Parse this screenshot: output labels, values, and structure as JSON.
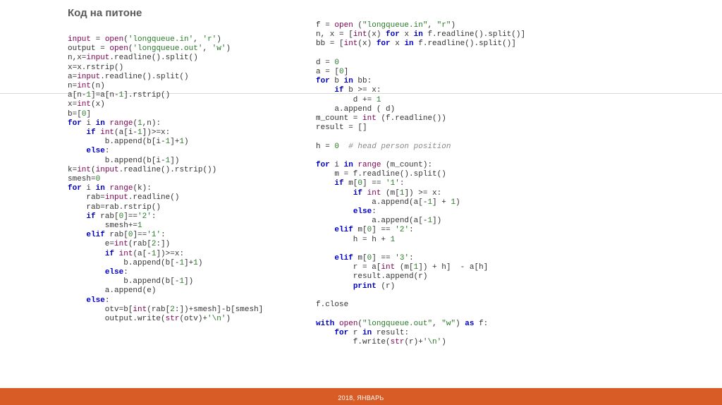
{
  "title": "Код на питоне",
  "footer": "2018, ЯНВАРЬ",
  "code": {
    "left": [
      {
        "t": "input",
        "c": "fn"
      },
      {
        "t": " = "
      },
      {
        "t": "open",
        "c": "fn"
      },
      {
        "t": "("
      },
      {
        "t": "'longqueue.in'",
        "c": "str"
      },
      {
        "t": ", "
      },
      {
        "t": "'r'",
        "c": "str"
      },
      {
        "t": ")"
      },
      {
        "br": 1
      },
      {
        "t": "output = "
      },
      {
        "t": "open",
        "c": "fn"
      },
      {
        "t": "("
      },
      {
        "t": "'longqueue.out'",
        "c": "str"
      },
      {
        "t": ", "
      },
      {
        "t": "'w'",
        "c": "str"
      },
      {
        "t": ")"
      },
      {
        "br": 1
      },
      {
        "t": "n,x="
      },
      {
        "t": "input",
        "c": "fn"
      },
      {
        "t": ".readline().split()"
      },
      {
        "br": 1
      },
      {
        "t": "x=x.rstrip()"
      },
      {
        "br": 1
      },
      {
        "t": "a="
      },
      {
        "t": "input",
        "c": "fn"
      },
      {
        "t": ".readline().split()"
      },
      {
        "br": 1
      },
      {
        "t": "n="
      },
      {
        "t": "int",
        "c": "fn"
      },
      {
        "t": "(n)"
      },
      {
        "br": 1
      },
      {
        "t": "a[n-"
      },
      {
        "t": "1",
        "c": "num"
      },
      {
        "t": "]=a[n-"
      },
      {
        "t": "1",
        "c": "num"
      },
      {
        "t": "].rstrip()"
      },
      {
        "br": 1
      },
      {
        "t": "x="
      },
      {
        "t": "int",
        "c": "fn"
      },
      {
        "t": "(x)"
      },
      {
        "br": 1
      },
      {
        "t": "b=["
      },
      {
        "t": "0",
        "c": "num"
      },
      {
        "t": "]"
      },
      {
        "br": 1
      },
      {
        "t": "for",
        "c": "kw"
      },
      {
        "t": " i "
      },
      {
        "t": "in",
        "c": "kw"
      },
      {
        "t": " "
      },
      {
        "t": "range",
        "c": "fn"
      },
      {
        "t": "("
      },
      {
        "t": "1",
        "c": "num"
      },
      {
        "t": ",n):"
      },
      {
        "br": 1
      },
      {
        "t": "    "
      },
      {
        "t": "if",
        "c": "kw"
      },
      {
        "t": " "
      },
      {
        "t": "int",
        "c": "fn"
      },
      {
        "t": "(a[i-"
      },
      {
        "t": "1",
        "c": "num"
      },
      {
        "t": "])>=x:"
      },
      {
        "br": 1
      },
      {
        "t": "        b.append(b[i-"
      },
      {
        "t": "1",
        "c": "num"
      },
      {
        "t": "]+"
      },
      {
        "t": "1",
        "c": "num"
      },
      {
        "t": ")"
      },
      {
        "br": 1
      },
      {
        "t": "    "
      },
      {
        "t": "else",
        "c": "kw"
      },
      {
        "t": ":"
      },
      {
        "br": 1
      },
      {
        "t": "        b.append(b[i-"
      },
      {
        "t": "1",
        "c": "num"
      },
      {
        "t": "])"
      },
      {
        "br": 1
      },
      {
        "t": "k="
      },
      {
        "t": "int",
        "c": "fn"
      },
      {
        "t": "("
      },
      {
        "t": "input",
        "c": "fn"
      },
      {
        "t": ".readline().rstrip())"
      },
      {
        "br": 1
      },
      {
        "t": "smesh="
      },
      {
        "t": "0",
        "c": "num"
      },
      {
        "br": 1
      },
      {
        "t": "for",
        "c": "kw"
      },
      {
        "t": " i "
      },
      {
        "t": "in",
        "c": "kw"
      },
      {
        "t": " "
      },
      {
        "t": "range",
        "c": "fn"
      },
      {
        "t": "(k):"
      },
      {
        "br": 1
      },
      {
        "t": "    rab="
      },
      {
        "t": "input",
        "c": "fn"
      },
      {
        "t": ".readline()"
      },
      {
        "br": 1
      },
      {
        "t": "    rab=rab.rstrip()"
      },
      {
        "br": 1
      },
      {
        "t": "    "
      },
      {
        "t": "if",
        "c": "kw"
      },
      {
        "t": " rab["
      },
      {
        "t": "0",
        "c": "num"
      },
      {
        "t": "]=="
      },
      {
        "t": "'2'",
        "c": "str"
      },
      {
        "t": ":"
      },
      {
        "br": 1
      },
      {
        "t": "        smesh+="
      },
      {
        "t": "1",
        "c": "num"
      },
      {
        "br": 1
      },
      {
        "t": "    "
      },
      {
        "t": "elif",
        "c": "kw"
      },
      {
        "t": " rab["
      },
      {
        "t": "0",
        "c": "num"
      },
      {
        "t": "]=="
      },
      {
        "t": "'1'",
        "c": "str"
      },
      {
        "t": ":"
      },
      {
        "br": 1
      },
      {
        "t": "        e="
      },
      {
        "t": "int",
        "c": "fn"
      },
      {
        "t": "(rab["
      },
      {
        "t": "2",
        "c": "num"
      },
      {
        "t": ":])"
      },
      {
        "br": 1
      },
      {
        "t": "        "
      },
      {
        "t": "if",
        "c": "kw"
      },
      {
        "t": " "
      },
      {
        "t": "int",
        "c": "fn"
      },
      {
        "t": "(a[-"
      },
      {
        "t": "1",
        "c": "num"
      },
      {
        "t": "])>=x:"
      },
      {
        "br": 1
      },
      {
        "t": "            b.append(b[-"
      },
      {
        "t": "1",
        "c": "num"
      },
      {
        "t": "]+"
      },
      {
        "t": "1",
        "c": "num"
      },
      {
        "t": ")"
      },
      {
        "br": 1
      },
      {
        "t": "        "
      },
      {
        "t": "else",
        "c": "kw"
      },
      {
        "t": ":"
      },
      {
        "br": 1
      },
      {
        "t": "            b.append(b[-"
      },
      {
        "t": "1",
        "c": "num"
      },
      {
        "t": "])"
      },
      {
        "br": 1
      },
      {
        "t": "        a.append(e)"
      },
      {
        "br": 1
      },
      {
        "t": "    "
      },
      {
        "t": "else",
        "c": "kw"
      },
      {
        "t": ":"
      },
      {
        "br": 1
      },
      {
        "t": "        otv=b["
      },
      {
        "t": "int",
        "c": "fn"
      },
      {
        "t": "(rab["
      },
      {
        "t": "2",
        "c": "num"
      },
      {
        "t": ":])+smesh]-b[smesh]"
      },
      {
        "br": 1
      },
      {
        "t": "        output.write("
      },
      {
        "t": "str",
        "c": "fn"
      },
      {
        "t": "(otv)+"
      },
      {
        "t": "'\\n'",
        "c": "str"
      },
      {
        "t": ")"
      }
    ],
    "right": [
      {
        "t": "f = "
      },
      {
        "t": "open",
        "c": "fn"
      },
      {
        "t": " ("
      },
      {
        "t": "\"longqueue.in\"",
        "c": "str"
      },
      {
        "t": ", "
      },
      {
        "t": "\"r\"",
        "c": "str"
      },
      {
        "t": ")"
      },
      {
        "br": 1
      },
      {
        "t": "n, x = ["
      },
      {
        "t": "int",
        "c": "fn"
      },
      {
        "t": "(x) "
      },
      {
        "t": "for",
        "c": "kw"
      },
      {
        "t": " x "
      },
      {
        "t": "in",
        "c": "kw"
      },
      {
        "t": " f.readline().split()]"
      },
      {
        "br": 1
      },
      {
        "t": "bb = ["
      },
      {
        "t": "int",
        "c": "fn"
      },
      {
        "t": "(x) "
      },
      {
        "t": "for",
        "c": "kw"
      },
      {
        "t": " x "
      },
      {
        "t": "in",
        "c": "kw"
      },
      {
        "t": " f.readline().split()]"
      },
      {
        "br": 1
      },
      {
        "br": 1
      },
      {
        "t": "d = "
      },
      {
        "t": "0",
        "c": "num"
      },
      {
        "br": 1
      },
      {
        "t": "a = ["
      },
      {
        "t": "0",
        "c": "num"
      },
      {
        "t": "]"
      },
      {
        "br": 1
      },
      {
        "t": "for",
        "c": "kw"
      },
      {
        "t": " b "
      },
      {
        "t": "in",
        "c": "kw"
      },
      {
        "t": " bb:"
      },
      {
        "br": 1
      },
      {
        "t": "    "
      },
      {
        "t": "if",
        "c": "kw"
      },
      {
        "t": " b >= x:"
      },
      {
        "br": 1
      },
      {
        "t": "        d += "
      },
      {
        "t": "1",
        "c": "num"
      },
      {
        "br": 1
      },
      {
        "t": "    a.append ( d)"
      },
      {
        "br": 1
      },
      {
        "t": "m_count = "
      },
      {
        "t": "int",
        "c": "fn"
      },
      {
        "t": " (f.readline())"
      },
      {
        "br": 1
      },
      {
        "t": "result = []"
      },
      {
        "br": 1
      },
      {
        "br": 1
      },
      {
        "t": "h = "
      },
      {
        "t": "0",
        "c": "num"
      },
      {
        "t": "  "
      },
      {
        "t": "# head person position",
        "c": "cm"
      },
      {
        "br": 1
      },
      {
        "br": 1
      },
      {
        "t": "for",
        "c": "kw"
      },
      {
        "t": " i "
      },
      {
        "t": "in",
        "c": "kw"
      },
      {
        "t": " "
      },
      {
        "t": "range",
        "c": "fn"
      },
      {
        "t": " (m_count):"
      },
      {
        "br": 1
      },
      {
        "t": "    m = f.readline().split()"
      },
      {
        "br": 1
      },
      {
        "t": "    "
      },
      {
        "t": "if",
        "c": "kw"
      },
      {
        "t": " m["
      },
      {
        "t": "0",
        "c": "num"
      },
      {
        "t": "] == "
      },
      {
        "t": "'1'",
        "c": "str"
      },
      {
        "t": ":"
      },
      {
        "br": 1
      },
      {
        "t": "        "
      },
      {
        "t": "if",
        "c": "kw"
      },
      {
        "t": " "
      },
      {
        "t": "int",
        "c": "fn"
      },
      {
        "t": " (m["
      },
      {
        "t": "1",
        "c": "num"
      },
      {
        "t": "]) >= x:"
      },
      {
        "br": 1
      },
      {
        "t": "            a.append(a[-"
      },
      {
        "t": "1",
        "c": "num"
      },
      {
        "t": "] + "
      },
      {
        "t": "1",
        "c": "num"
      },
      {
        "t": ")"
      },
      {
        "br": 1
      },
      {
        "t": "        "
      },
      {
        "t": "else",
        "c": "kw"
      },
      {
        "t": ":"
      },
      {
        "br": 1
      },
      {
        "t": "            a.append(a[-"
      },
      {
        "t": "1",
        "c": "num"
      },
      {
        "t": "])"
      },
      {
        "br": 1
      },
      {
        "t": "    "
      },
      {
        "t": "elif",
        "c": "kw"
      },
      {
        "t": " m["
      },
      {
        "t": "0",
        "c": "num"
      },
      {
        "t": "] == "
      },
      {
        "t": "'2'",
        "c": "str"
      },
      {
        "t": ":"
      },
      {
        "br": 1
      },
      {
        "t": "        h = h + "
      },
      {
        "t": "1",
        "c": "num"
      },
      {
        "br": 1
      },
      {
        "br": 1
      },
      {
        "t": "    "
      },
      {
        "t": "elif",
        "c": "kw"
      },
      {
        "t": " m["
      },
      {
        "t": "0",
        "c": "num"
      },
      {
        "t": "] == "
      },
      {
        "t": "'3'",
        "c": "str"
      },
      {
        "t": ":"
      },
      {
        "br": 1
      },
      {
        "t": "        r = a["
      },
      {
        "t": "int",
        "c": "fn"
      },
      {
        "t": " (m["
      },
      {
        "t": "1",
        "c": "num"
      },
      {
        "t": "]) + h]  - a[h]"
      },
      {
        "br": 1
      },
      {
        "t": "        result.append(r)"
      },
      {
        "br": 1
      },
      {
        "t": "        "
      },
      {
        "t": "print",
        "c": "kw"
      },
      {
        "t": " (r)"
      },
      {
        "br": 1
      },
      {
        "br": 1
      },
      {
        "t": "f.close"
      },
      {
        "br": 1
      },
      {
        "br": 1
      },
      {
        "t": "with",
        "c": "kw"
      },
      {
        "t": " "
      },
      {
        "t": "open",
        "c": "fn"
      },
      {
        "t": "("
      },
      {
        "t": "\"longqueue.out\"",
        "c": "str"
      },
      {
        "t": ", "
      },
      {
        "t": "\"w\"",
        "c": "str"
      },
      {
        "t": ") "
      },
      {
        "t": "as",
        "c": "kw"
      },
      {
        "t": " f:"
      },
      {
        "br": 1
      },
      {
        "t": "    "
      },
      {
        "t": "for",
        "c": "kw"
      },
      {
        "t": " r "
      },
      {
        "t": "in",
        "c": "kw"
      },
      {
        "t": " result:"
      },
      {
        "br": 1
      },
      {
        "t": "        f.write("
      },
      {
        "t": "str",
        "c": "fn"
      },
      {
        "t": "(r)+"
      },
      {
        "t": "'\\n'",
        "c": "str"
      },
      {
        "t": ")"
      }
    ]
  }
}
